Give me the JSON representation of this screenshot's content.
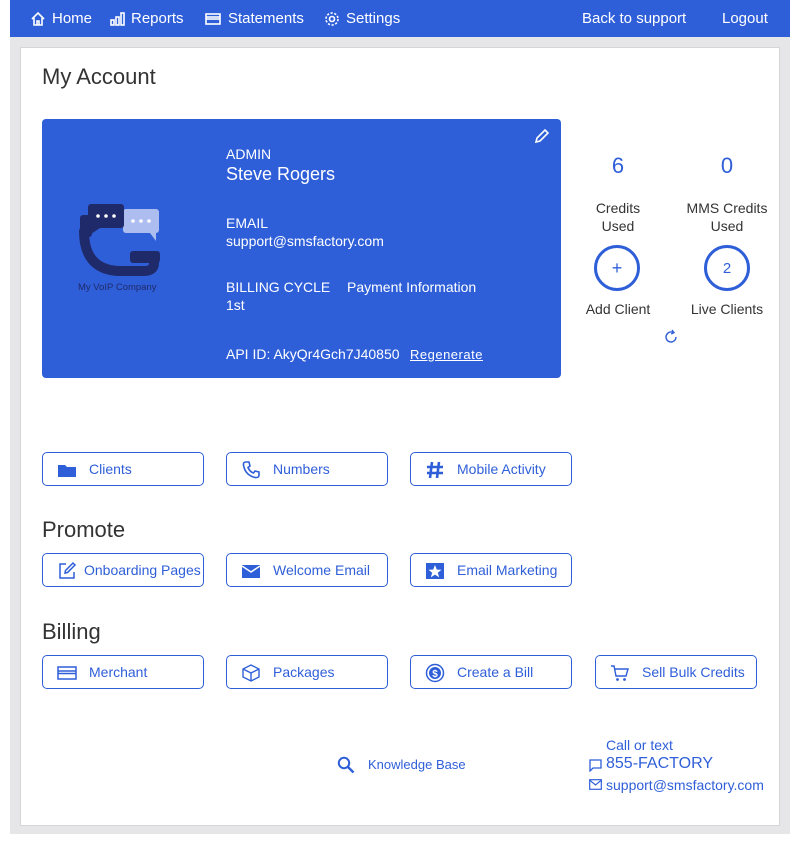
{
  "nav": {
    "home": "Home",
    "reports": "Reports",
    "statements": "Statements",
    "settings": "Settings",
    "back": "Back to support",
    "logout": "Logout"
  },
  "page": {
    "title": "My Account"
  },
  "card": {
    "logo_text": "My VoIP Company",
    "role_label": "ADMIN",
    "name": "Steve Rogers",
    "email_label": "EMAIL",
    "email": "support@smsfactory.com",
    "billing_label": "BILLING CYCLE",
    "billing_value": "1st",
    "payment_info": "Payment Information",
    "api_id": "API ID: AkyQr4Gch7J40850",
    "regenerate": "Regenerate"
  },
  "stats": {
    "credits_used_value": "6",
    "credits_used_label_1": "Credits",
    "credits_used_label_2": "Used",
    "mms_value": "0",
    "mms_label_1": "MMS Credits",
    "mms_label_2": "Used",
    "add_client_symbol": "+",
    "add_client_label": "Add Client",
    "live_clients_value": "2",
    "live_clients_label": "Live Clients"
  },
  "quick": {
    "clients": "Clients",
    "numbers": "Numbers",
    "mobile_activity": "Mobile Activity"
  },
  "promote": {
    "title": "Promote",
    "onboarding": "Onboarding Pages",
    "welcome_email": "Welcome Email",
    "email_marketing": "Email Marketing"
  },
  "billing": {
    "title": "Billing",
    "merchant": "Merchant",
    "packages": "Packages",
    "create_bill": "Create a Bill",
    "sell_bulk": "Sell Bulk Credits"
  },
  "footer": {
    "knowledge_base": "Knowledge Base",
    "call_or_text": "Call or text",
    "phone": "855-FACTORY",
    "email": "support@smsfactory.com"
  },
  "colors": {
    "accent": "#2f5fd8",
    "logo_navy": "#1f2a6b"
  }
}
